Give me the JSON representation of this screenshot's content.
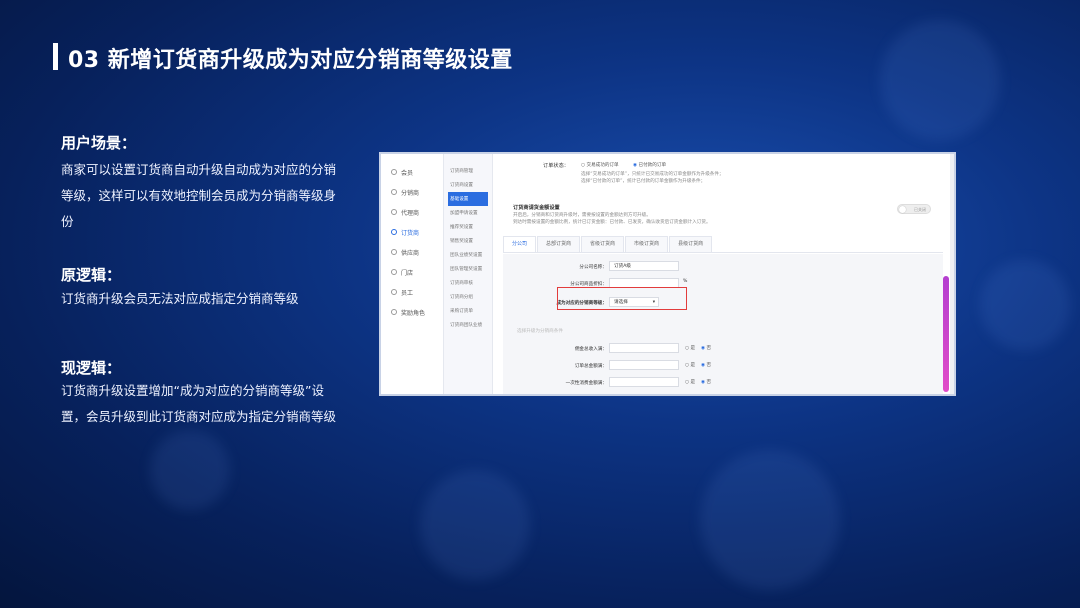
{
  "title": "03 新增订货商升级成为对应分销商等级设置",
  "sections": [
    {
      "heading": "用户场景：",
      "body": "商家可以设置订货商自动升级自动成为对应的分销等级，这样可以有效地控制会员成为分销商等级身份"
    },
    {
      "heading": "原逻辑：",
      "body": "订货商升级会员无法对应成指定分销商等级"
    },
    {
      "heading": "现逻辑：",
      "body": "订货商升级设置增加“成为对应的分销商等级”设置，会员升级到此订货商对应成为指定分销商等级"
    }
  ],
  "screenshot": {
    "nav": [
      "会员",
      "分销商",
      "代理商",
      "订货商",
      "供应商",
      "门店",
      "员工",
      "奖励角色"
    ],
    "nav_active": 3,
    "subnav": [
      "订货商管理",
      "订货商设置",
      "基础设置",
      "加盟申请设置",
      "推荐奖设置",
      "销售奖设置",
      "团队业绩奖设置",
      "团队管理奖设置",
      "订货商审核",
      "订货商分组",
      "采购订货单",
      "订货商团队业绩"
    ],
    "subnav_active": 2,
    "order_status_label": "订单状态：",
    "order_status_opt1": "交易成功的订单",
    "order_status_opt2": "已付款的订单",
    "note1": "选择“交易成功的订单”，只统计已交易成功的订单金额作为升级条件；",
    "note2": "选择“已付款的订单”，统计已付款的订单金额作为升级条件；",
    "section_title": "订货商请货金额设置",
    "section_desc1": "开启后，分销商和订货商升级时，需要按设置的金额达到方可升级。",
    "section_desc2": "到达时需按设置的金额比例，统计已订货金额：已付款、已发货，确认收货后订货金额计入订货。",
    "toggle_label": "已关闭",
    "tabs": [
      "分公司",
      "总部订货商",
      "省级订货商",
      "市级订货商",
      "县级订货商"
    ],
    "tab_active": 0,
    "form_name_label": "分公司名称：",
    "form_name_value": "订货A级",
    "form_discount_label": "分公司商品折扣：",
    "form_discount_unit": "%",
    "highlight_label": "成为对应的分销商等级：",
    "highlight_value": "请选择",
    "upgrade_hint": "选择升级为分销商条件",
    "cond_rows": [
      {
        "label": "佣金总收入满：",
        "yes": "是",
        "no": "否"
      },
      {
        "label": "订单总金额满：",
        "yes": "是",
        "no": "否"
      },
      {
        "label": "一次性消费金额满：",
        "yes": "是",
        "no": "否"
      }
    ]
  }
}
